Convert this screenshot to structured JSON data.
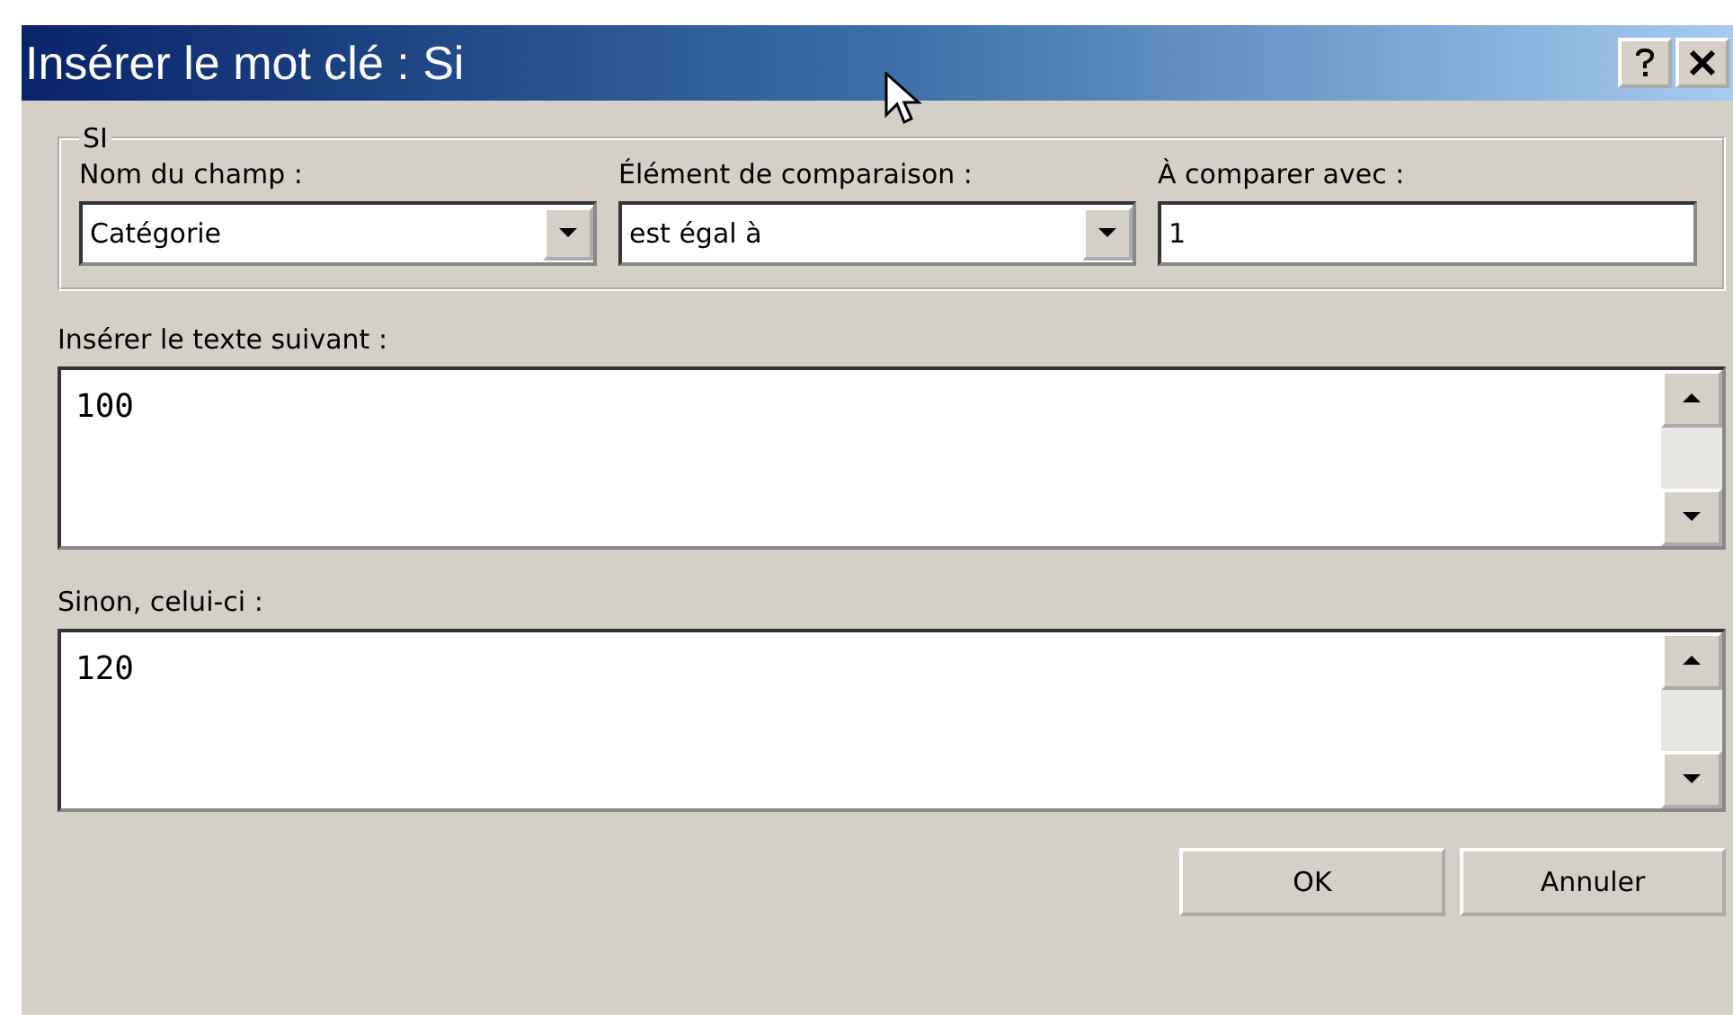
{
  "window": {
    "title": "Insérer le mot clé : Si"
  },
  "condition_group": {
    "legend": "SI",
    "fields": [
      {
        "kind": "dropdown",
        "label": "Nom du champ :",
        "value": "Catégorie"
      },
      {
        "kind": "dropdown",
        "label": "Élément de comparaison :",
        "value": "est égal à"
      },
      {
        "kind": "text",
        "label": "À comparer avec :",
        "value": "1"
      }
    ]
  },
  "text_areas": [
    {
      "label": "Insérer le texte suivant :",
      "value": "100"
    },
    {
      "label": "Sinon, celui-ci :",
      "value": "120"
    }
  ],
  "buttons": [
    "OK",
    "Annuler"
  ]
}
